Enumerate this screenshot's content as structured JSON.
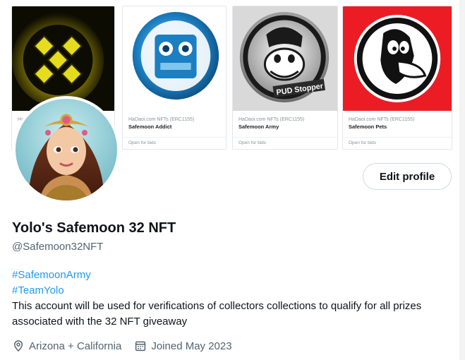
{
  "banner": {
    "cards": [
      {
        "collection": "Ha",
        "name": "",
        "footer": ""
      },
      {
        "collection": "HaDaoi.com NFTs (ERC1155)",
        "name": "Safemoon Addict",
        "footer": "Open for bids"
      },
      {
        "collection": "HaDaoi.com NFTs (ERC1155)",
        "name": "Safemoon Army",
        "footer": "Open for bids",
        "art_text": "PUD Stopper"
      },
      {
        "collection": "HaDaoi.com NFTs (ERC1155)",
        "name": "Safemoon Pets",
        "footer": "Open for bids"
      }
    ]
  },
  "profile": {
    "edit_label": "Edit profile",
    "display_name": "Yolo's Safemoon 32 NFT",
    "handle": "@Safemoon32NFT",
    "hashtags": [
      "#SafemoonArmy",
      "#TeamYolo"
    ],
    "bio": "This account will be used for verifications of collectors collections to qualify for all prizes associated with the 32 NFT giveaway",
    "location": "Arizona + California",
    "joined": "Joined May 2023"
  },
  "icons": {
    "location": "location-pin-icon",
    "joined": "calendar-icon"
  },
  "colors": {
    "link": "#1d9bf0",
    "secondary_text": "#536471",
    "primary_text": "#0f1419",
    "button_border": "#cfd9de"
  }
}
